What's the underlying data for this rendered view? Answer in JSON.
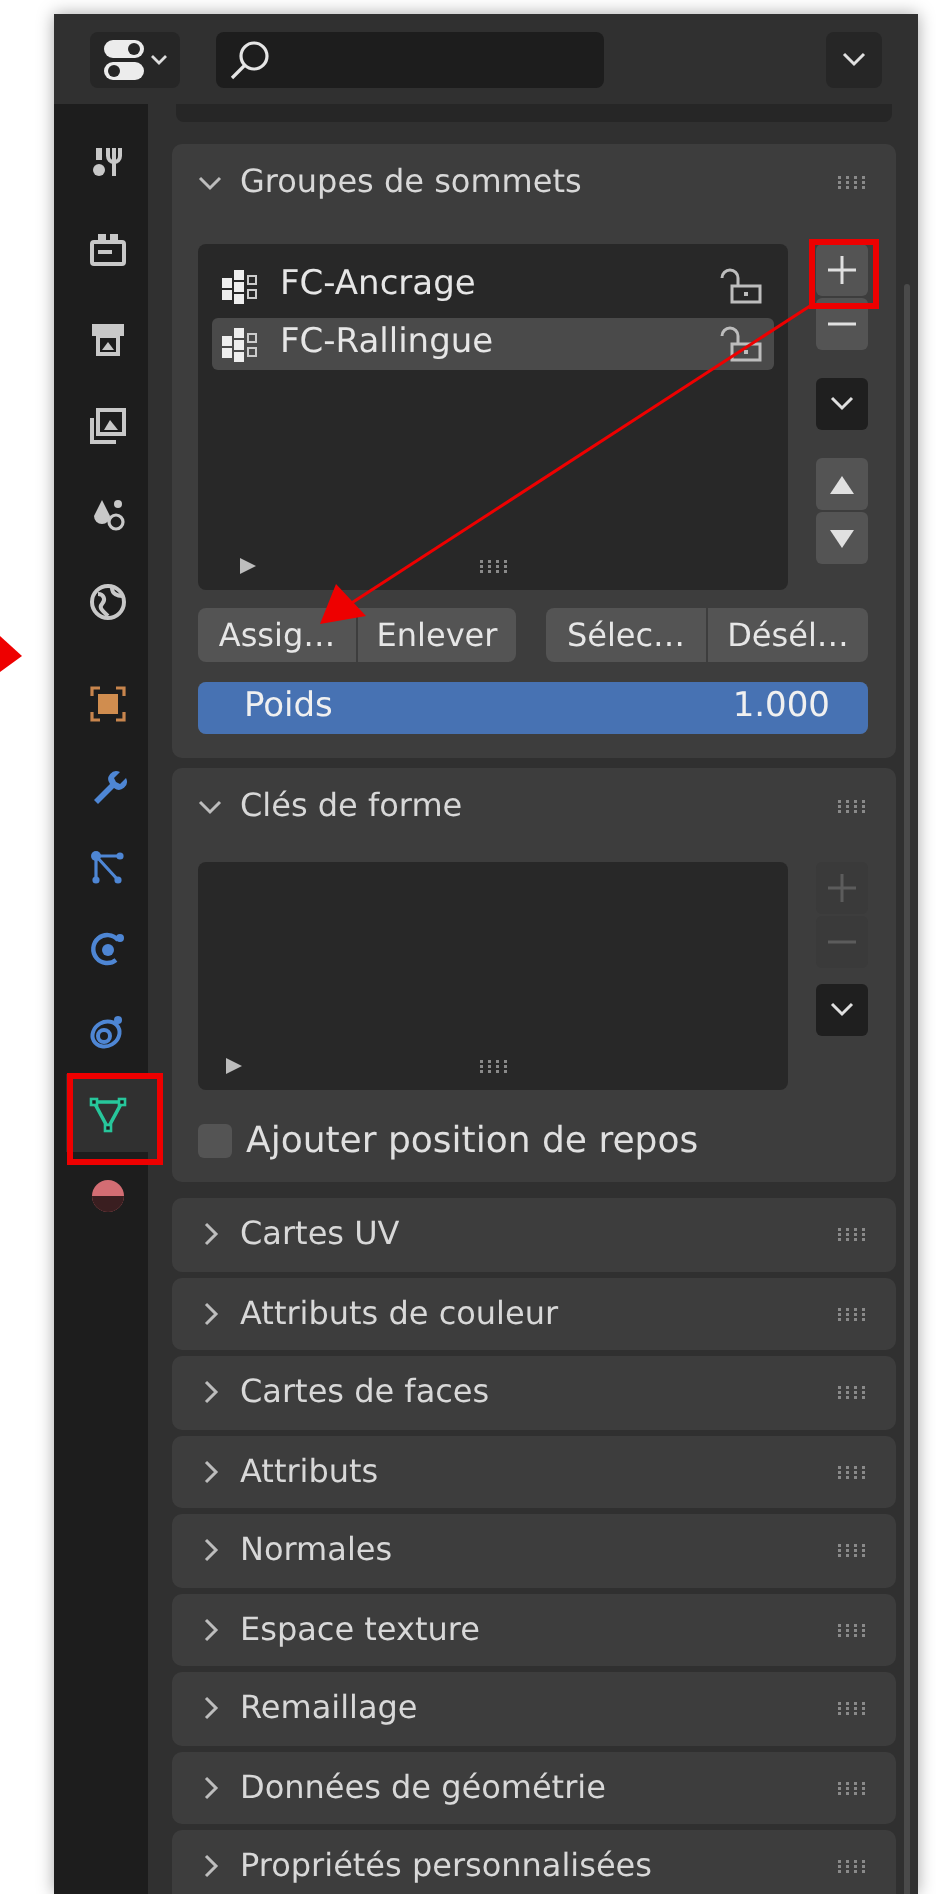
{
  "tabs": [
    {
      "selected": false
    },
    {
      "selected": false
    },
    {
      "selected": false
    },
    {
      "selected": false
    },
    {
      "selected": false
    },
    {
      "selected": false
    },
    {
      "selected": false
    },
    {
      "selected": false
    },
    {
      "selected": false
    },
    {
      "selected": false
    },
    {
      "selected": false
    },
    {
      "selected": true
    },
    {
      "selected": false
    }
  ],
  "vertex_groups": {
    "title": "Groupes de sommets",
    "expanded": true,
    "items": [
      {
        "name": "FC-Ancrage",
        "selected": false,
        "locked": false
      },
      {
        "name": "FC-Rallingue",
        "selected": true,
        "locked": false
      }
    ],
    "buttons": [
      "Assig…",
      "Enlever",
      "Sélec…",
      "Désél…"
    ],
    "weight": {
      "label": "Poids",
      "value": "1.000",
      "level": 1
    }
  },
  "shape_keys": {
    "title": "Clés de forme",
    "expanded": true,
    "add_disabled": true,
    "checkbox": {
      "label": "Ajouter position de repos",
      "checked": false
    }
  },
  "sections": [
    {
      "title": "Cartes UV",
      "expanded": false
    },
    {
      "title": "Attributs de couleur",
      "expanded": false
    },
    {
      "title": "Cartes de faces",
      "expanded": false
    },
    {
      "title": "Attributs",
      "expanded": false
    },
    {
      "title": "Normales",
      "expanded": false
    },
    {
      "title": "Espace texture",
      "expanded": false
    },
    {
      "title": "Remaillage",
      "expanded": false
    },
    {
      "title": "Données de géométrie",
      "expanded": false
    },
    {
      "title": "Propriétés personnalisées",
      "expanded": false
    }
  ]
}
